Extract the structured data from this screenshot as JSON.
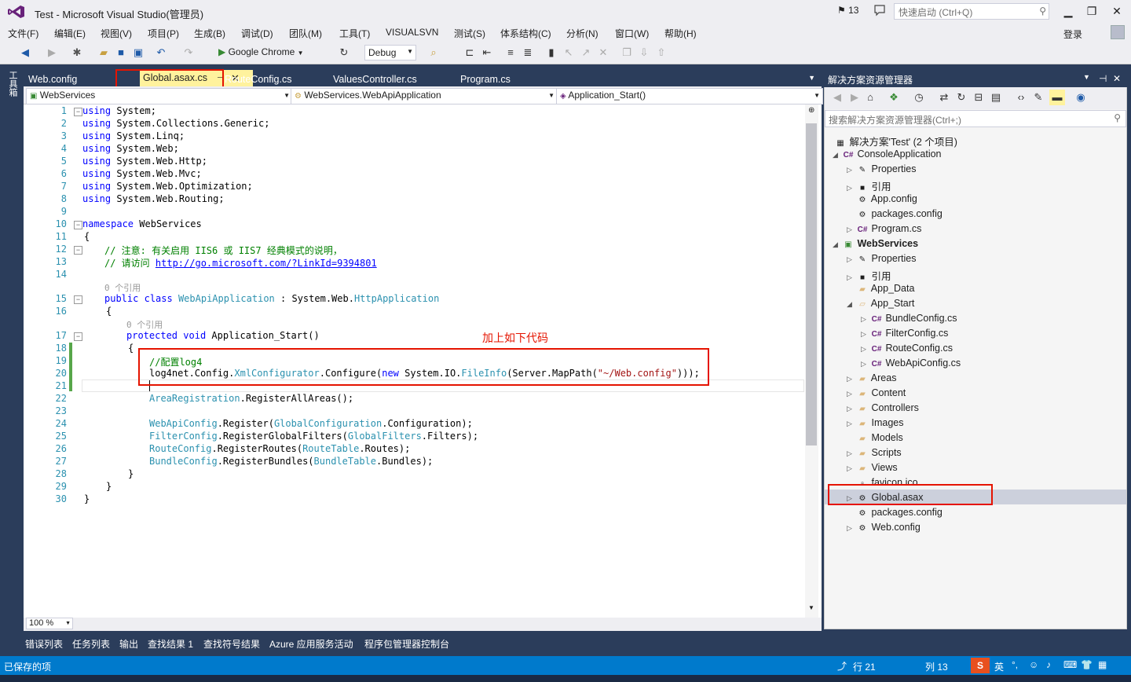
{
  "window": {
    "title": "Test - Microsoft Visual Studio(管理员)",
    "notifications": "13",
    "quick_launch_placeholder": "快速启动 (Ctrl+Q)",
    "minimize": "▁",
    "maximize": "❐",
    "close": "✕"
  },
  "menu": [
    "文件(F)",
    "编辑(E)",
    "视图(V)",
    "项目(P)",
    "生成(B)",
    "调试(D)",
    "团队(M)",
    "工具(T)",
    "VISUALSVN",
    "测试(S)",
    "体系结构(C)",
    "分析(N)",
    "窗口(W)",
    "帮助(H)"
  ],
  "login": "登录",
  "toolbar": {
    "browser": "Google Chrome",
    "config": "Debug"
  },
  "toolbox_label": "工具箱",
  "tabs": [
    {
      "label": "Web.config"
    },
    {
      "label": "Global.asax.cs"
    },
    {
      "label": "RouteConfig.cs"
    },
    {
      "label": "ValuesController.cs"
    },
    {
      "label": "Program.cs"
    }
  ],
  "navbar": {
    "project": "WebServices",
    "type": "WebServices.WebApiApplication",
    "member": "Application_Start()"
  },
  "code": {
    "l1": "System;",
    "l2": "System.Collections.Generic;",
    "l3": "System.Linq;",
    "l4": "System.Web;",
    "l5": "System.Web.Http;",
    "l6": "System.Web.Mvc;",
    "l7": "System.Web.Optimization;",
    "l8": "System.Web.Routing;",
    "kw_using": "using",
    "kw_namespace": "namespace",
    "ns_name": "WebServices",
    "c12": "// 注意: 有关启用 IIS6 或 IIS7 经典模式的说明，",
    "c13": "// 请访问 ",
    "link13": "http://go.microsoft.com/?LinkId=9394801",
    "refs": "0 个引用",
    "kw_public": "public",
    "kw_class": "class",
    "class_name": "WebApiApplication",
    "colon": " : ",
    "base_ns": "System.Web.",
    "base_type": "HttpApplication",
    "kw_protected": "protected",
    "kw_void": "void",
    "method": "Application_Start()",
    "c19": "//配置log4",
    "l20a": "log4net.Config.",
    "l20b": "XmlConfigurator",
    "l20c": ".Configure(",
    "kw_new": "new",
    "l20d": " System.IO.",
    "l20e": "FileInfo",
    "l20f": "(Server.MapPath(",
    "l20g": "\"~/Web.config\"",
    "l20h": ")));",
    "t22": "AreaRegistration",
    "l22": ".RegisterAllAreas();",
    "t24": "WebApiConfig",
    "l24a": ".Register(",
    "t24b": "GlobalConfiguration",
    "l24b": ".Configuration);",
    "t25": "FilterConfig",
    "l25a": ".RegisterGlobalFilters(",
    "t25b": "GlobalFilters",
    "l25b": ".Filters);",
    "t26": "RouteConfig",
    "l26a": ".RegisterRoutes(",
    "t26b": "RouteTable",
    "l26b": ".Routes);",
    "t27": "BundleConfig",
    "l27a": ".RegisterBundles(",
    "t27b": "BundleTable",
    "l27b": ".Bundles);",
    "brace_open": "{",
    "brace_close": "}"
  },
  "annotation": "加上如下代码",
  "zoom": "100 %",
  "solution_explorer": {
    "title": "解决方案资源管理器",
    "search_placeholder": "搜索解决方案资源管理器(Ctrl+;)",
    "items": [
      "解决方案'Test' (2 个项目)",
      "ConsoleApplication",
      "Properties",
      "引用",
      "App.config",
      "packages.config",
      "Program.cs",
      "WebServices",
      "Properties",
      "引用",
      "App_Data",
      "App_Start",
      "BundleConfig.cs",
      "FilterConfig.cs",
      "RouteConfig.cs",
      "WebApiConfig.cs",
      "Areas",
      "Content",
      "Controllers",
      "Images",
      "Models",
      "Scripts",
      "Views",
      "favicon.ico",
      "Global.asax",
      "packages.config",
      "Web.config"
    ]
  },
  "bottom_tabs": [
    "错误列表",
    "任务列表",
    "输出",
    "查找结果 1",
    "查找符号结果",
    "Azure 应用服务活动",
    "程序包管理器控制台"
  ],
  "status": {
    "left": "已保存的项",
    "line": "行 21",
    "col": "列 13",
    "ime": "英"
  }
}
